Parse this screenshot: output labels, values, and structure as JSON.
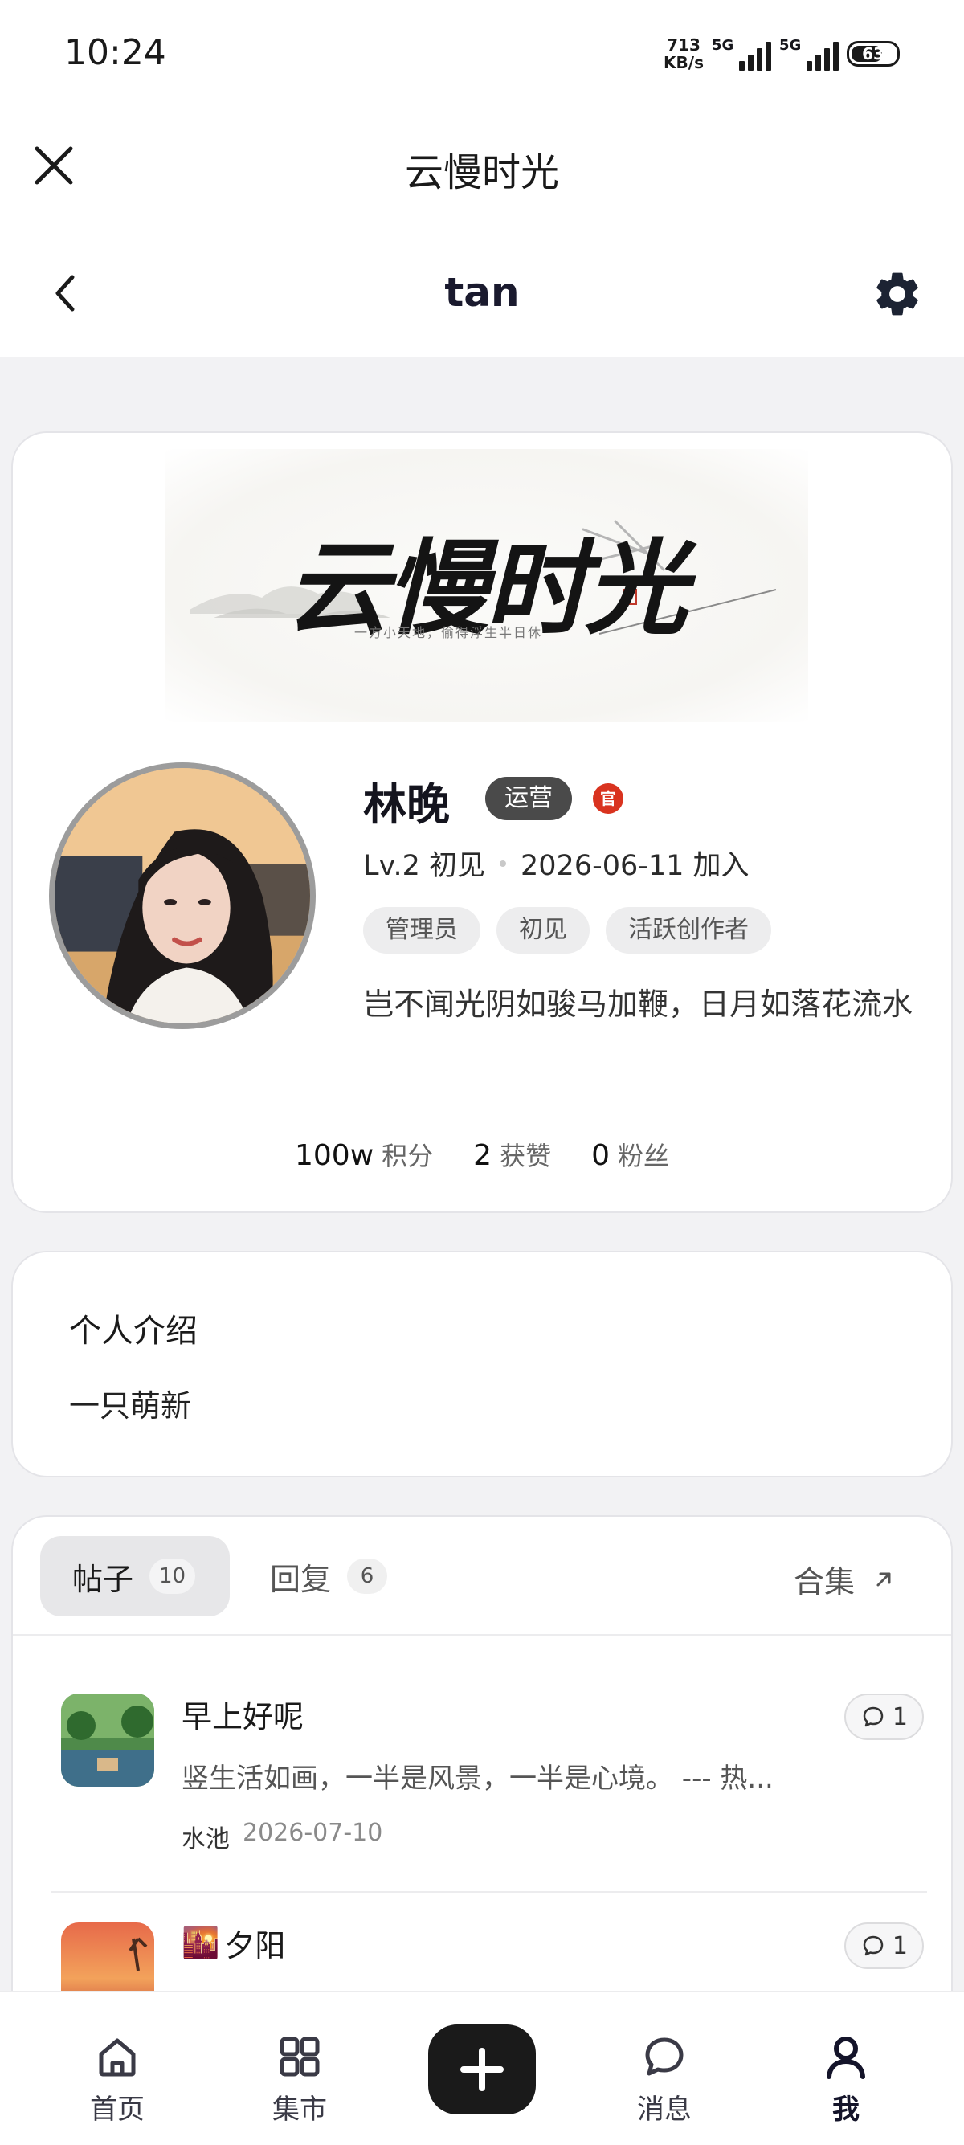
{
  "status_bar": {
    "time": "10:24",
    "net_speed_value": "713",
    "net_speed_unit": "KB/s",
    "signal1": "5G",
    "signal2": "5G",
    "battery": "63"
  },
  "app_header": {
    "title": "云慢时光",
    "close_icon": "close-icon"
  },
  "nav_header": {
    "title": "tan",
    "back_icon": "chevron-left-icon",
    "settings_icon": "gear-icon"
  },
  "profile": {
    "banner_title": "云慢时光",
    "banner_subtitle": "一方小天地，偷得浮生半日休",
    "name": "林晚",
    "role_badge": "运营",
    "official_mark": "官",
    "level": "Lv.2 初见",
    "joined": "2026-06-11 加入",
    "tags": [
      "管理员",
      "初见",
      "活跃创作者"
    ],
    "signature": "岂不闻光阴如骏马加鞭，日月如落花流水",
    "stats": [
      {
        "value": "100w",
        "label": "积分"
      },
      {
        "value": "2",
        "label": "获赞"
      },
      {
        "value": "0",
        "label": "粉丝"
      }
    ]
  },
  "intro": {
    "title": "个人介绍",
    "text": "一只萌新"
  },
  "tabs": {
    "posts_label": "帖子",
    "posts_count": "10",
    "replies_label": "回复",
    "replies_count": "6",
    "collection_label": "合集"
  },
  "posts": [
    {
      "title": "早上好呢",
      "excerpt": "竖生活如画，一半是风景，一半是心境。 --- 热...",
      "board": "水池",
      "date": "2026-07-10",
      "comments": "1"
    },
    {
      "title": "夕阳",
      "title_emoji": "🌇",
      "comments": "1"
    }
  ],
  "bottom_nav": [
    {
      "label": "首页",
      "icon": "home-icon"
    },
    {
      "label": "集市",
      "icon": "grid-icon"
    },
    {
      "label": "",
      "icon": "plus-icon"
    },
    {
      "label": "消息",
      "icon": "chat-icon"
    },
    {
      "label": "我",
      "icon": "user-icon"
    }
  ],
  "colors": {
    "accent_dark": "#1a1a1a",
    "official_red": "#d9331f",
    "page_bg": "#f2f2f4"
  }
}
